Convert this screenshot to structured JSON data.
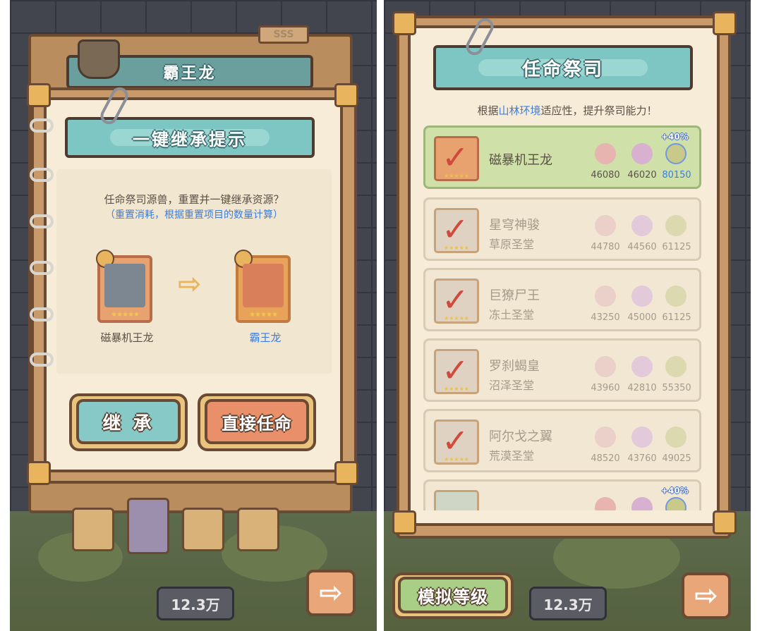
{
  "left_screen": {
    "background_title": "霸王龙",
    "background_tag": "SSS",
    "dialog": {
      "title": "一键继承提示",
      "message": "任命祭司源兽，重置并一键继承资源？",
      "note": "（重置消耗，根据重置项目的数量计算）",
      "from_card": {
        "name": "磁暴机王龙",
        "stars": "★★★★★"
      },
      "to_card": {
        "name": "霸王龙",
        "stars": "★★★★★"
      },
      "arrow": "⇨",
      "inherit_button": "继 承",
      "direct_appoint_button": "直接任命"
    },
    "counter": "12.3万",
    "next_arrow": "⇨"
  },
  "right_screen": {
    "title": "任命祭司",
    "subtitle_prefix": "根据",
    "subtitle_highlight": "山林环境",
    "subtitle_suffix": "适应性，提升祭司能力！",
    "items": [
      {
        "name": "磁暴机王龙",
        "location": "",
        "values": [
          "46080",
          "46020",
          "80150"
        ],
        "bonus": "+40%",
        "active": true
      },
      {
        "name": "星穹神骏",
        "location": "草原圣堂",
        "values": [
          "44780",
          "44560",
          "61125"
        ],
        "bonus": "",
        "active": false
      },
      {
        "name": "巨獠尸王",
        "location": "冻土圣堂",
        "values": [
          "43250",
          "45000",
          "61125"
        ],
        "bonus": "",
        "active": false
      },
      {
        "name": "罗刹蝎皇",
        "location": "沼泽圣堂",
        "values": [
          "43960",
          "42810",
          "55350"
        ],
        "bonus": "",
        "active": false
      },
      {
        "name": "阿尔戈之翼",
        "location": "荒漠圣堂",
        "values": [
          "48520",
          "43760",
          "49025"
        ],
        "bonus": "",
        "active": false
      }
    ],
    "partial_item_bonus": "+40%",
    "simulate_button": "模拟等级",
    "counter": "12.3万",
    "next_arrow": "⇨"
  },
  "colors": {
    "banner": "#7ec6c4",
    "inherit_button": "#86c9c6",
    "appoint_button": "#e9906a",
    "simulate_button": "#a9cf86",
    "highlight_text": "#3b7de0"
  }
}
